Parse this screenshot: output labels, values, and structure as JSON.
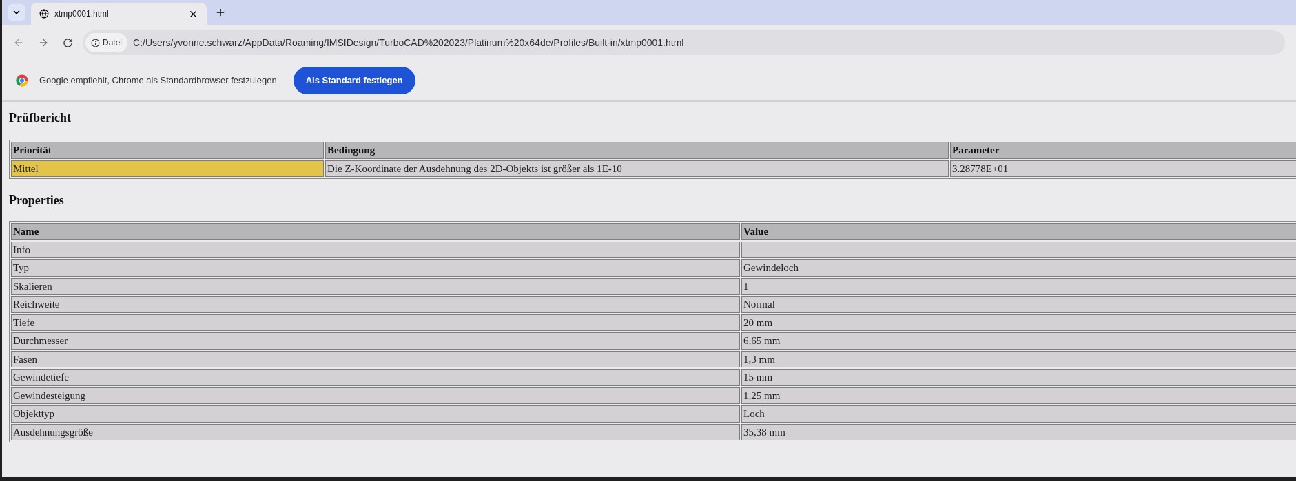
{
  "browser": {
    "tabs": [
      {
        "title": "xtmp0001.html",
        "selected": true
      }
    ],
    "address": {
      "badge": "Datei",
      "url": "C:/Users/yvonne.schwarz/AppData/Roaming/IMSIDesign/TurboCAD%202023/Platinum%20x64de/Profiles/Built-in/xtmp0001.html"
    },
    "infobar": {
      "message": "Google empfiehlt, Chrome als Standardbrowser festzulegen",
      "button": "Als Standard festlegen"
    }
  },
  "report": {
    "title": "Prüfbericht",
    "columns": [
      "Priorität",
      "Bedingung",
      "Parameter"
    ],
    "rows": [
      {
        "priority": "Mittel",
        "color": "#e2c44a",
        "condition": "Die Z-Koordinate der Ausdehnung des 2D-Objekts ist größer als 1E-10",
        "parameter": "3.28778E+01"
      }
    ]
  },
  "properties": {
    "title": "Properties",
    "columns": [
      "Name",
      "Value"
    ],
    "rows": [
      [
        "Info",
        ""
      ],
      [
        "Typ",
        "Gewindeloch"
      ],
      [
        "Skalieren",
        "1"
      ],
      [
        "Reichweite",
        "Normal"
      ],
      [
        "Tiefe",
        "20 mm"
      ],
      [
        "Durchmesser",
        "6,65 mm"
      ],
      [
        "Fasen",
        "1,3 mm"
      ],
      [
        "Gewindetiefe",
        "15 mm"
      ],
      [
        "Gewindesteigung",
        "1,25 mm"
      ],
      [
        "Objekttyp",
        "Loch"
      ],
      [
        "Ausdehnungsgröße",
        "35,38 mm"
      ]
    ]
  }
}
